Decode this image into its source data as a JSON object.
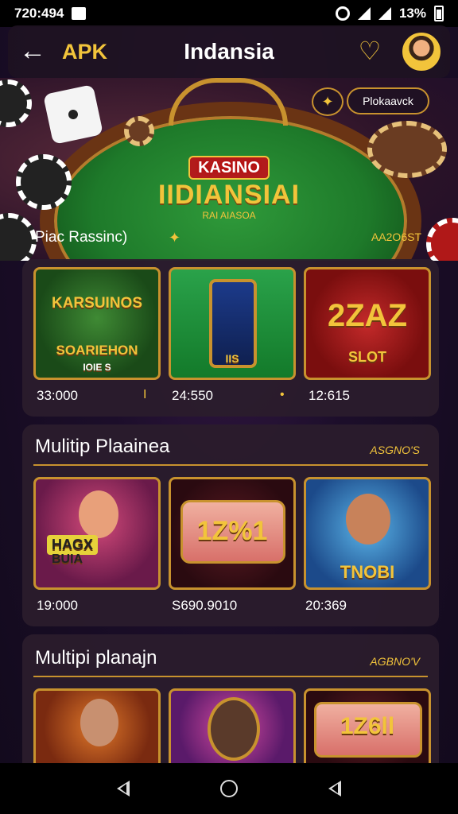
{
  "status_bar": {
    "time": "720:494",
    "battery": "13%"
  },
  "header": {
    "back_icon": "arrow-left-icon",
    "apk_label": "APK",
    "title": "Indansia"
  },
  "hero": {
    "logo_top": "KASINO",
    "logo_main": "IIDIANSIAI",
    "logo_sub": "RAI AIASOA",
    "caption": "Piac Rassinc)",
    "right_text": "AA2O6ST",
    "promo_button": "Plokaavck"
  },
  "sections": [
    {
      "title": "",
      "more": "",
      "cards": [
        {
          "art_title": "KARSUINOS",
          "art_sub": "SOARIEHON",
          "art_badge": "IOIE S",
          "value": "33:000",
          "mark": "I"
        },
        {
          "art_title": "",
          "art_sub": "IIS",
          "value": "24:550",
          "mark": "•"
        },
        {
          "art_title": "2ZAZ",
          "art_sub": "SLOT",
          "value": "12:615",
          "mark": ""
        }
      ]
    },
    {
      "title": "Mulitip Plaainea",
      "more": "ASGNO'S",
      "cards": [
        {
          "art_title": "HAGX",
          "art_sub": "BUIA",
          "value": "19:000"
        },
        {
          "art_title": "1Z%1",
          "art_sub": "",
          "value": "S690.9010"
        },
        {
          "art_title": "",
          "art_sub": "TNOBI",
          "value": "20:369"
        }
      ]
    },
    {
      "title": "Multipi planajn",
      "more": "AGBNO'V",
      "cards": [
        {
          "art_title": "",
          "value": ""
        },
        {
          "art_title": "",
          "value": ""
        },
        {
          "art_title": "1Z6ll",
          "value": ""
        }
      ]
    }
  ],
  "colors": {
    "accent_gold": "#f2c43b",
    "frame_gold": "#c8922e",
    "card_bg": "#2a1c2c"
  }
}
